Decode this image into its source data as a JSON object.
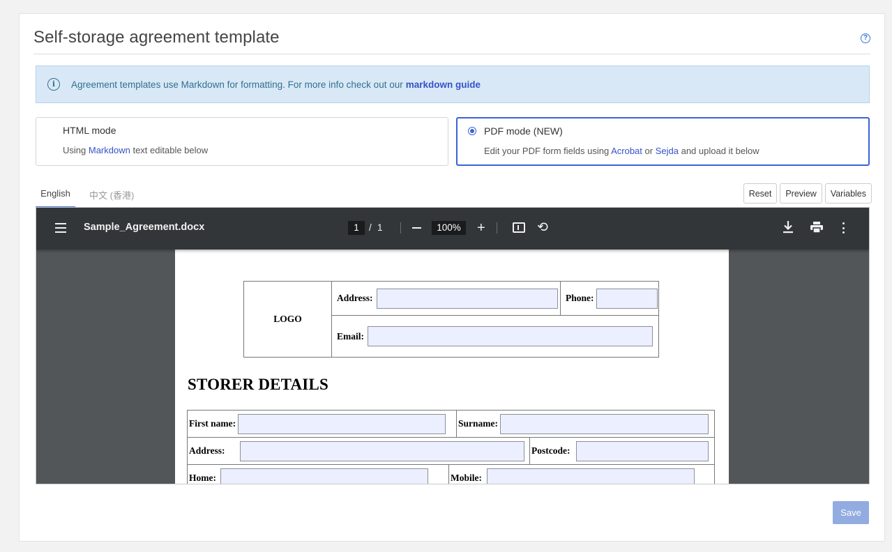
{
  "page": {
    "title": "Self-storage agreement template",
    "help_icon": "question-circle-icon"
  },
  "info_banner": {
    "icon": "info-circle-icon",
    "text": "Agreement templates use Markdown for formatting. For more info check out our",
    "link": "markdown guide"
  },
  "modes": {
    "html": {
      "title": "HTML mode",
      "desc_prefix": "Using",
      "desc_link": "Markdown",
      "desc_suffix": "text editable below",
      "selected": false
    },
    "pdf": {
      "title": "PDF mode (NEW)",
      "desc_prefix": "Edit your PDF form fields using",
      "link1": "Acrobat",
      "desc_mid": "or",
      "link2": "Sejda",
      "desc_suffix": "and upload it below",
      "selected": true
    }
  },
  "tabs": [
    {
      "label": "English",
      "active": true
    },
    {
      "label": "中文 (香港)",
      "active": false
    }
  ],
  "toolbar": {
    "reset": "Reset",
    "preview": "Preview",
    "variables": "Variables"
  },
  "viewer": {
    "file_name": "Sample_Agreement.docx",
    "page_current": "1",
    "page_separator": "/",
    "page_total": "1",
    "zoom": "100%",
    "icons": [
      "menu-icon",
      "zoom-out-icon",
      "zoom-in-icon",
      "fit-page-icon",
      "rotate-icon",
      "download-icon",
      "print-icon",
      "more-vert-icon"
    ]
  },
  "document": {
    "header": {
      "logo": "LOGO",
      "address": "Address:",
      "phone": "Phone:",
      "email": "Email:"
    },
    "section_title": "STORER DETAILS",
    "labels": {
      "first_name": "First name:",
      "surname": "Surname:",
      "address": "Address:",
      "postcode": "Postcode:",
      "home": "Home:",
      "mobile": "Mobile:"
    }
  },
  "footer": {
    "save": "Save"
  },
  "colors": {
    "accent": "#3a63d1",
    "info_bg": "#d9e8f6",
    "viewer_bar": "#323639",
    "viewer_bg": "#525659",
    "field_bg": "#ecefff",
    "save_bg": "#92abe0"
  }
}
